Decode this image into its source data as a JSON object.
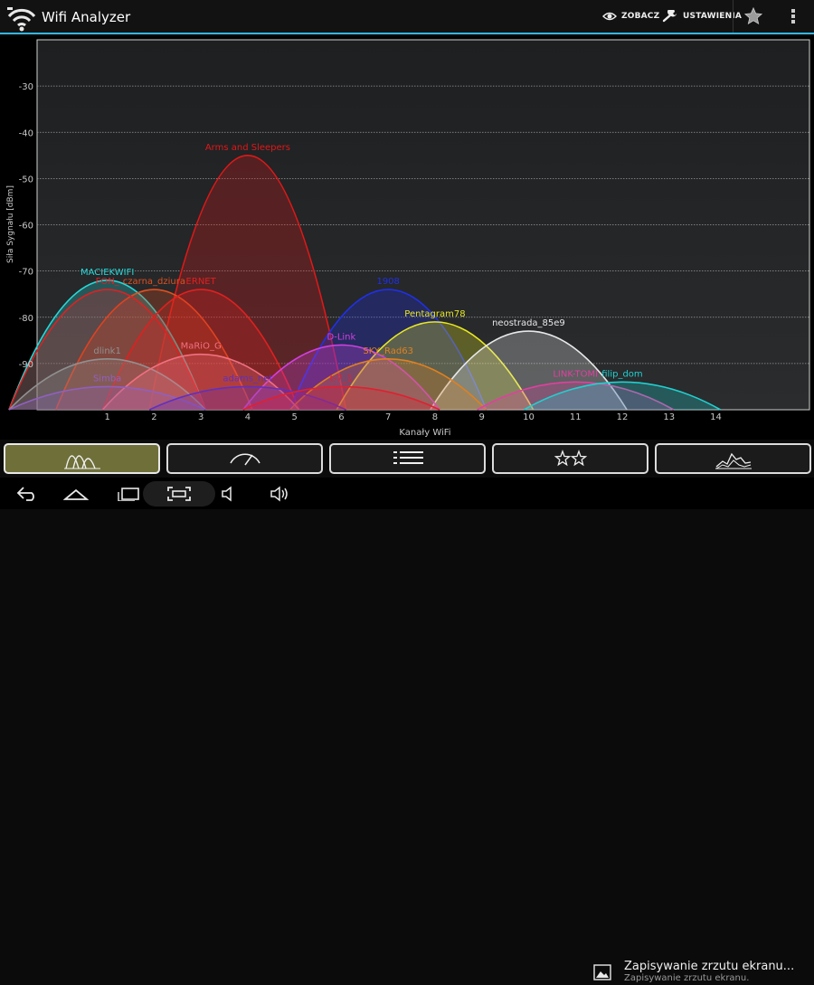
{
  "app": {
    "title": "Wifi Analyzer",
    "accent_color": "#33b5e5",
    "icon": "wifi-analyzer-icon"
  },
  "actionbar": {
    "view_label": "ZOBACZ",
    "view_icon": "eye-icon",
    "settings_label": "USTAWIENIA",
    "settings_icon": "wrench-icon",
    "rate_icon": "star-icon",
    "overflow_icon": "overflow-menu-icon"
  },
  "chart_data": {
    "type": "area",
    "ylabel": "Siła Sygnału [dBm]",
    "xlabel": "Kanały WiFi",
    "ylim": [
      -100,
      -20
    ],
    "xlim": [
      -0.5,
      16
    ],
    "x_ticks": [
      1,
      2,
      3,
      4,
      5,
      6,
      7,
      8,
      9,
      10,
      11,
      12,
      13,
      14
    ],
    "y_ticks": [
      -30,
      -40,
      -50,
      -60,
      -70,
      -80,
      -90
    ],
    "grid": true,
    "series": [
      {
        "name": "Arms and Sleepers",
        "channel": 4,
        "signal": -45,
        "color": "#e01818"
      },
      {
        "name": "MACIEKWIFI",
        "channel": 1,
        "signal": -72,
        "color": "#28d8d8"
      },
      {
        "name": "czarna_dziura",
        "channel": 2,
        "signal": -74,
        "color": "#e05020"
      },
      {
        "name": "FON_",
        "channel": 1,
        "signal": -74,
        "color": "#e02020"
      },
      {
        "name": "ERNET",
        "channel": 3,
        "signal": -74,
        "color": "#e02020"
      },
      {
        "name": "1908",
        "channel": 7,
        "signal": -74,
        "color": "#2030e8"
      },
      {
        "name": "Pentagram78",
        "channel": 8,
        "signal": -81,
        "color": "#e8e820"
      },
      {
        "name": "neostrada_85e9",
        "channel": 10,
        "signal": -83,
        "color": "#e8e8e8"
      },
      {
        "name": "D-Link",
        "channel": 6,
        "signal": -86,
        "color": "#d040e0"
      },
      {
        "name": "SKY_Rad63",
        "channel": 7,
        "signal": -89,
        "color": "#e08020"
      },
      {
        "name": "dlink1",
        "channel": 1,
        "signal": -89,
        "color": "#909090"
      },
      {
        "name": "MaRiO_G",
        "channel": 3,
        "signal": -88,
        "color": "#f07080"
      },
      {
        "name": "Simba",
        "channel": 1,
        "signal": -95,
        "color": "#9060c0"
      },
      {
        "name": "adams_net",
        "channel": 4,
        "signal": -95,
        "color": "#6030c0"
      },
      {
        "name": "t-7_1",
        "channel": 6,
        "signal": -95,
        "color": "#e02030"
      },
      {
        "name": "LINK-TOMI",
        "channel": 11,
        "signal": -94,
        "color": "#e040a0"
      },
      {
        "name": "filip_dom",
        "channel": 12,
        "signal": -94,
        "color": "#20d0d0"
      }
    ]
  },
  "tabs": [
    {
      "name": "tab-channel-graph",
      "icon": "channel-graph-icon",
      "active": true
    },
    {
      "name": "tab-signal-meter",
      "icon": "signal-meter-icon",
      "active": false
    },
    {
      "name": "tab-ap-list",
      "icon": "ap-list-icon",
      "active": false
    },
    {
      "name": "tab-channel-rating",
      "icon": "star-rating-icon",
      "active": false
    },
    {
      "name": "tab-time-graph",
      "icon": "time-graph-icon",
      "active": false
    }
  ],
  "navbar": {
    "back_icon": "back-icon",
    "home_icon": "home-icon",
    "recent_icon": "recent-apps-icon",
    "screenshot_icon": "screenshot-icon",
    "volume_down_icon": "volume-down-icon",
    "volume_up_icon": "volume-up-icon"
  },
  "notification": {
    "title": "Zapisywanie zrzutu ekranu...",
    "subtitle": "Zapisywanie zrzutu ekranu.",
    "icon": "image-icon"
  }
}
